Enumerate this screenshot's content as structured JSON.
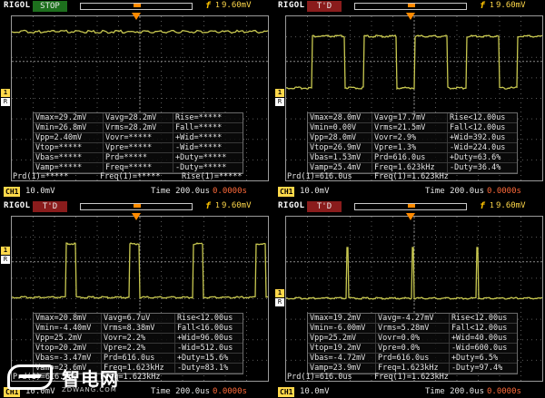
{
  "colors": {
    "trace": "#c8c850",
    "grid_dot": "#5a5a5a",
    "accent": "#ffd84a",
    "trigger": "#ff8a00"
  },
  "panels": [
    {
      "brand": "RIGOL",
      "status": "STOP",
      "edge": "f",
      "ch": "1",
      "trig_level": "9.60mV",
      "ch1_badge": "CH1",
      "volts": "10.0mV",
      "timebase": "Time 200.0us",
      "trig_offset": "0.0000s",
      "meas": [
        [
          "Vmax=29.2mV",
          "Vavg=28.2mV",
          "Rise=*****"
        ],
        [
          "Vmin=26.8mV",
          "Vrms=28.2mV",
          "Fall=*****"
        ],
        [
          "Vpp=2.40mV",
          "Vovr=*****",
          "+Wid=*****"
        ],
        [
          "Vtop=*****",
          "Vpre=*****",
          "-Wid=*****"
        ],
        [
          "Vbas=*****",
          "Prd=*****",
          "+Duty=*****"
        ],
        [
          "Vamp=*****",
          "Freq=*****",
          "-Duty=*****"
        ]
      ],
      "bottom": [
        "Prd(1)=*****",
        "Freq(1)=*****",
        "Rise(1)=*****"
      ],
      "wave": "flat"
    },
    {
      "brand": "RIGOL",
      "status": "T'D",
      "edge": "f",
      "ch": "1",
      "trig_level": "9.60mV",
      "ch1_badge": "CH1",
      "volts": "10.0mV",
      "timebase": "Time 200.0us",
      "trig_offset": "0.0000s",
      "meas": [
        [
          "Vmax=28.0mV",
          "Vavg=17.7mV",
          "Rise<12.00us"
        ],
        [
          "Vmin=0.00V",
          "Vrms=21.5mV",
          "Fall<12.00us"
        ],
        [
          "Vpp=28.0mV",
          "Vovr=2.9%",
          "+Wid=392.0us"
        ],
        [
          "Vtop=26.9mV",
          "Vpre=1.3%",
          "-Wid=224.0us"
        ],
        [
          "Vbas=1.53mV",
          "Prd=616.0us",
          "+Duty=63.6%"
        ],
        [
          "Vamp=25.4mV",
          "Freq=1.623kHz",
          "-Duty=36.4%"
        ]
      ],
      "bottom": [
        "Prd(1)=616.0us",
        "Freq(1)=1.623kHz",
        ""
      ],
      "wave": "square64"
    },
    {
      "brand": "RIGOL",
      "status": "T'D",
      "edge": "f",
      "ch": "1",
      "trig_level": "9.60mV",
      "ch1_badge": "CH1",
      "volts": "10.0mV",
      "timebase": "Time 200.0us",
      "trig_offset": "0.0000s",
      "meas": [
        [
          "Vmax=20.8mV",
          "Vavg=6.7uV",
          "Rise<12.00us"
        ],
        [
          "Vmin=-4.40mV",
          "Vrms=8.38mV",
          "Fall<16.00us"
        ],
        [
          "Vpp=25.2mV",
          "Vovr=2.2%",
          "+Wid=96.00us"
        ],
        [
          "Vtop=20.2mV",
          "Vpre=2.2%",
          "-Wid=512.0us"
        ],
        [
          "Vbas=-3.47mV",
          "Prd=616.0us",
          "+Duty=15.6%"
        ],
        [
          "Vamp=23.6mV",
          "Freq=1.623kHz",
          "-Duty=83.1%"
        ]
      ],
      "bottom": [
        "Prd(1)=616.0us",
        "Freq=1.623kHz",
        ""
      ],
      "wave": "pulse16"
    },
    {
      "brand": "RIGOL",
      "status": "T'D",
      "edge": "f",
      "ch": "1",
      "trig_level": "9.60mV",
      "ch1_badge": "CH1",
      "volts": "10.0mV",
      "timebase": "Time 200.0us",
      "trig_offset": "0.0000s",
      "meas": [
        [
          "Vmax=19.2mV",
          "Vavg=-4.27mV",
          "Rise<12.00us"
        ],
        [
          "Vmin=-6.00mV",
          "Vrms=5.28mV",
          "Fall<12.00us"
        ],
        [
          "Vpp=25.2mV",
          "Vovr=0.0%",
          "+Wid=40.00us"
        ],
        [
          "Vtop=19.2mV",
          "Vpre=0.0%",
          "-Wid=600.0us"
        ],
        [
          "Vbas=-4.72mV",
          "Prd=616.0us",
          "+Duty=6.5%"
        ],
        [
          "Vamp=23.9mV",
          "Freq=1.623kHz",
          "-Duty=97.4%"
        ]
      ],
      "bottom": [
        "Prd(1)=616.0us",
        "Freq(1)=1.623kHz",
        ""
      ],
      "wave": "spike"
    }
  ],
  "watermark": {
    "name": "智电网",
    "url": "ZDWANG.COM"
  }
}
